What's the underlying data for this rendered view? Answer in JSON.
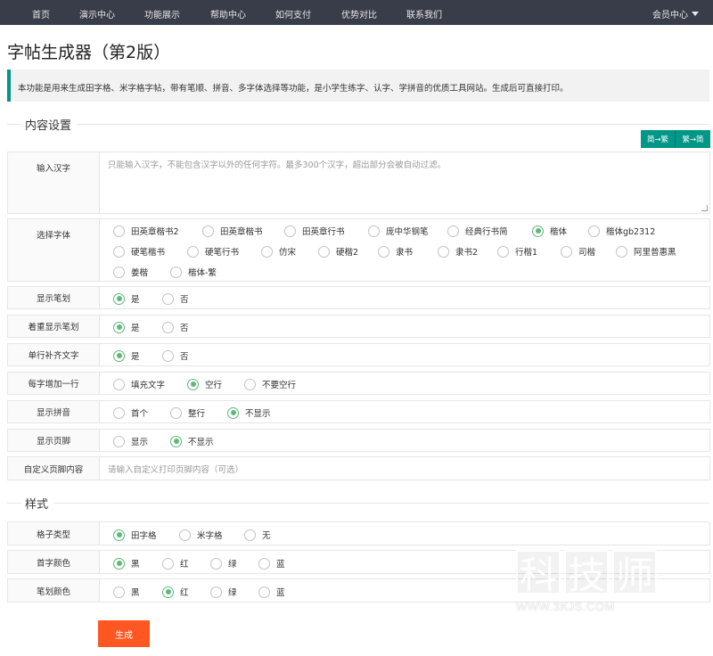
{
  "nav": {
    "items": [
      "首页",
      "演示中心",
      "功能展示",
      "帮助中心",
      "如何支付",
      "优势对比",
      "联系我们"
    ],
    "member": "会员中心"
  },
  "title": "字帖生成器（第2版）",
  "notice": "本功能是用来生成田字格、米字格字帖，带有笔顺、拼音、多字体选择等功能，是小学生练字、认字、学拼音的优质工具网站。生成后可直接打印。",
  "content_section": "内容设置",
  "convert": {
    "s2t": "简→繁",
    "t2s": "繁→简"
  },
  "input": {
    "label": "输入汉字",
    "placeholder": "只能输入汉字，不能包含汉字以外的任何字符。最多300个汉字，超出部分会被自动过滤。"
  },
  "font": {
    "label": "选择字体",
    "options": [
      "田英章楷书2",
      "田英章楷书",
      "田英章行书",
      "庞中华钢笔",
      "经典行书简",
      "楷体",
      "楷体gb2312",
      "硬笔楷书",
      "硬笔行书",
      "仿宋",
      "硬楷2",
      "隶书",
      "隶书2",
      "行楷1",
      "司楷",
      "阿里普惠黑",
      "姜楷",
      "楷体-繁"
    ],
    "selected": 5
  },
  "show_strokes": {
    "label": "显示笔划",
    "options": [
      "是",
      "否"
    ],
    "selected": 0
  },
  "emphasize_strokes": {
    "label": "着重显示笔划",
    "options": [
      "是",
      "否"
    ],
    "selected": 0
  },
  "fill_line": {
    "label": "单行补齐文字",
    "options": [
      "是",
      "否"
    ],
    "selected": 0
  },
  "add_line": {
    "label": "每字增加一行",
    "options": [
      "填充文字",
      "空行",
      "不要空行"
    ],
    "selected": 1
  },
  "pinyin": {
    "label": "显示拼音",
    "options": [
      "首个",
      "整行",
      "不显示"
    ],
    "selected": 2
  },
  "footer": {
    "label": "显示页脚",
    "options": [
      "显示",
      "不显示"
    ],
    "selected": 1
  },
  "custom_footer": {
    "label": "自定义页脚内容",
    "placeholder": "请输入自定义打印页脚内容（可选）"
  },
  "style_section": "样式",
  "grid_type": {
    "label": "格子类型",
    "options": [
      "田字格",
      "米字格",
      "无"
    ],
    "selected": 0
  },
  "first_color": {
    "label": "首字颜色",
    "options": [
      "黑",
      "红",
      "绿",
      "蓝"
    ],
    "selected": 0
  },
  "stroke_color": {
    "label": "笔划颜色",
    "options": [
      "黑",
      "红",
      "绿",
      "蓝"
    ],
    "selected": 1
  },
  "generate": "生成",
  "watermark": {
    "chars": [
      "科",
      "技",
      "师"
    ],
    "url": "WWW.3KJS.COM"
  },
  "colors": {
    "nav_bg": "#393d49",
    "accent": "#009688",
    "radio_on": "#5fb878",
    "generate_bg": "#ff5722"
  }
}
